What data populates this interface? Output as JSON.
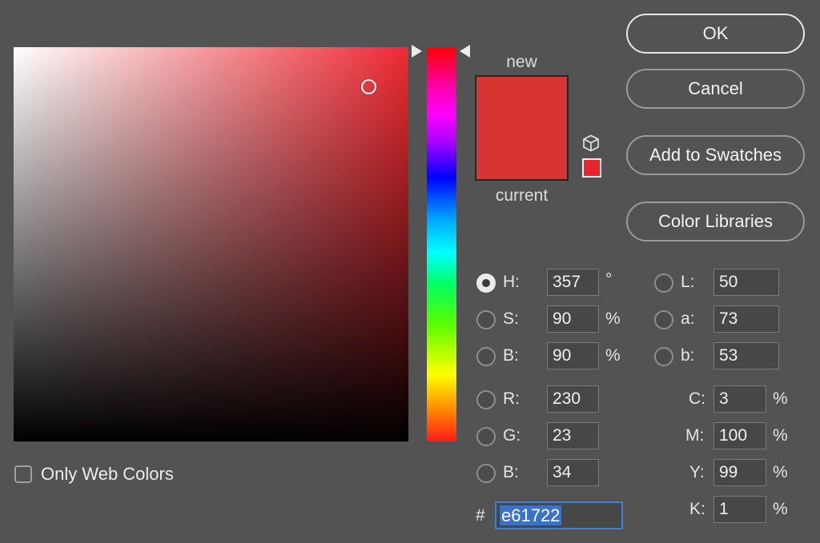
{
  "picker": {
    "hue_degrees": 357,
    "saturation_fraction": 0.9,
    "brightness_fraction": 0.9
  },
  "swatches": {
    "new_label": "new",
    "current_label": "current",
    "new_color": "#d83432",
    "current_color": "#d83432",
    "gamut_warning_color": "#e6262f",
    "cube_icon": "cube-icon"
  },
  "buttons": {
    "ok": "OK",
    "cancel": "Cancel",
    "add_to_swatches": "Add to Swatches",
    "color_libraries": "Color Libraries"
  },
  "hsb": {
    "h": {
      "label": "H:",
      "value": "357",
      "unit": "°",
      "checked": true
    },
    "s": {
      "label": "S:",
      "value": "90",
      "unit": "%"
    },
    "b": {
      "label": "B:",
      "value": "90",
      "unit": "%"
    }
  },
  "rgb": {
    "r": {
      "label": "R:",
      "value": "230"
    },
    "g": {
      "label": "G:",
      "value": "23"
    },
    "b": {
      "label": "B:",
      "value": "34"
    }
  },
  "lab": {
    "l": {
      "label": "L:",
      "value": "50"
    },
    "a": {
      "label": "a:",
      "value": "73"
    },
    "b": {
      "label": "b:",
      "value": "53"
    }
  },
  "cmyk": {
    "c": {
      "label": "C:",
      "value": "3",
      "unit": "%"
    },
    "m": {
      "label": "M:",
      "value": "100",
      "unit": "%"
    },
    "y": {
      "label": "Y:",
      "value": "99",
      "unit": "%"
    },
    "k": {
      "label": "K:",
      "value": "1",
      "unit": "%"
    }
  },
  "hex": {
    "label": "#",
    "value": "e61722"
  },
  "web_colors": {
    "label": "Only Web Colors",
    "checked": false
  }
}
